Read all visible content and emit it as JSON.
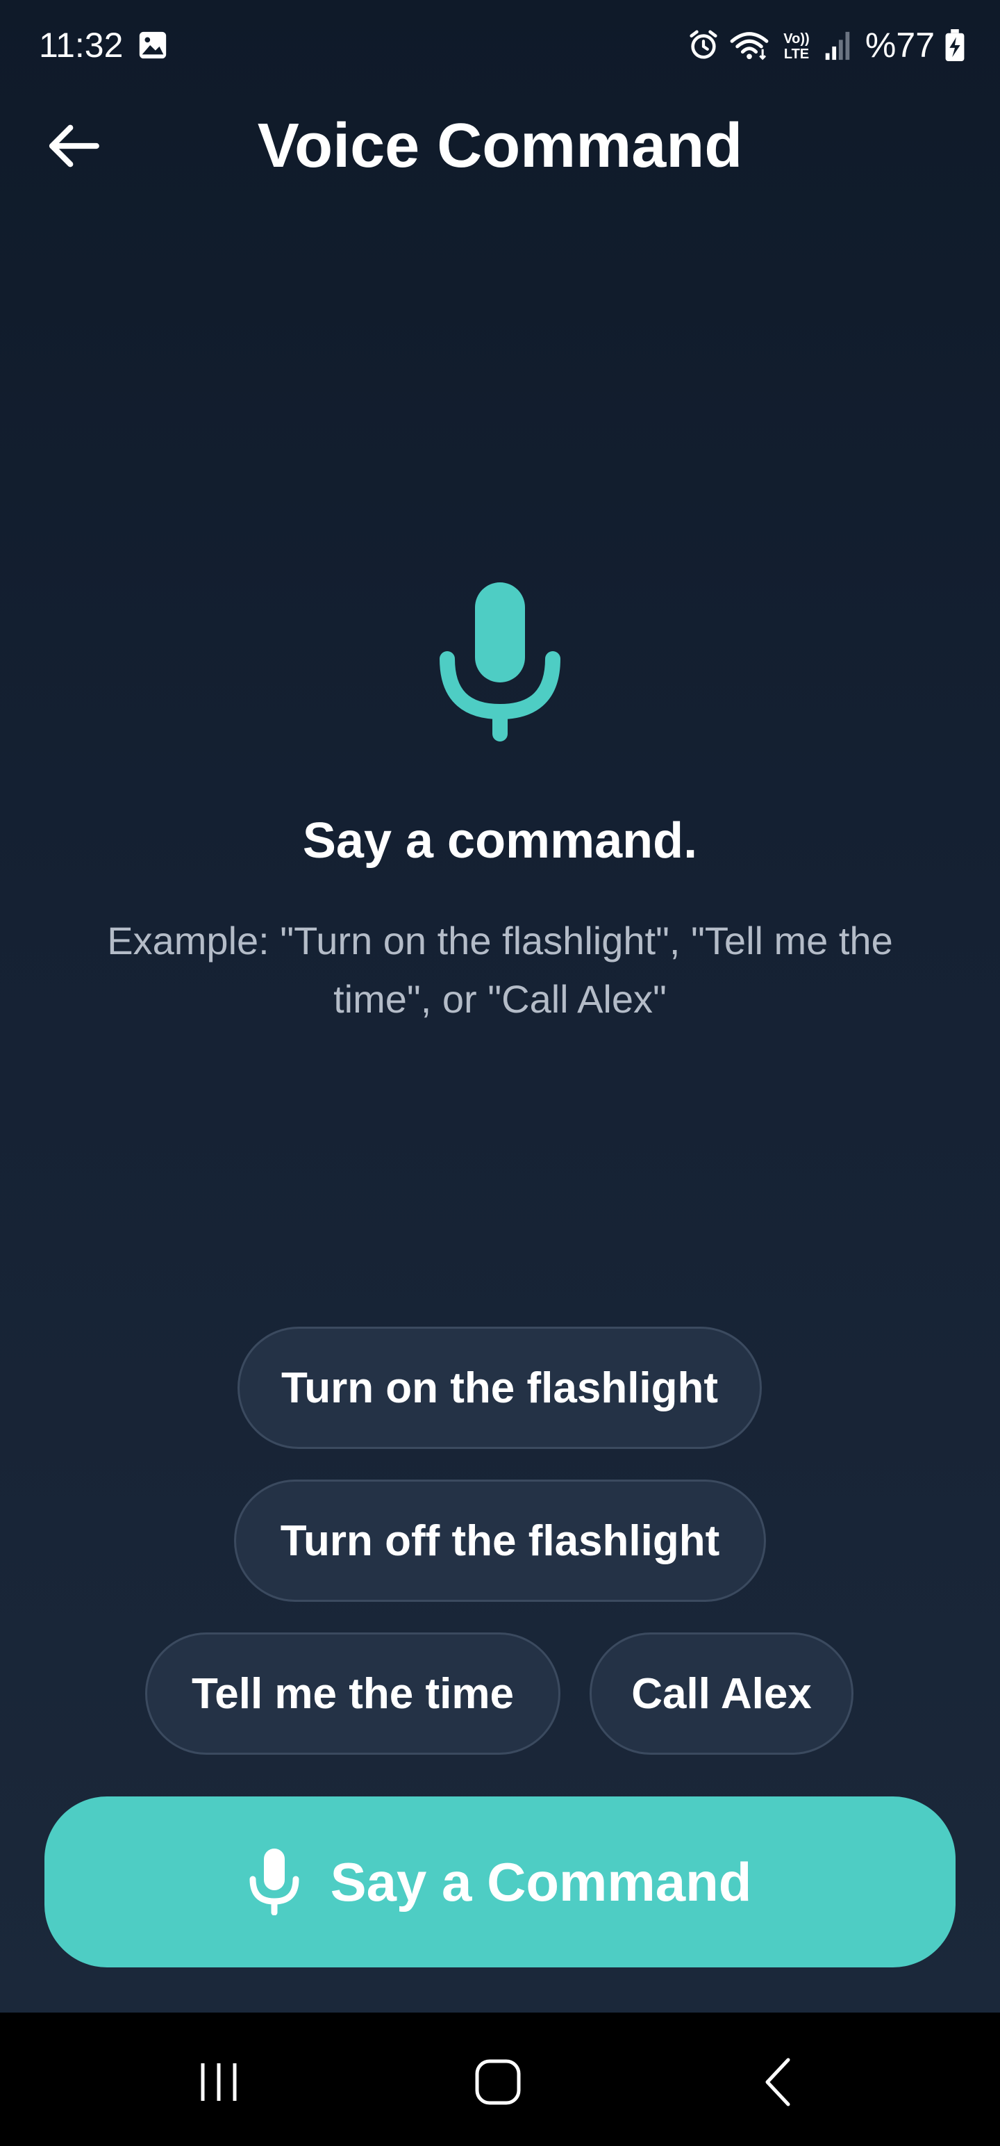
{
  "status_bar": {
    "time": "11:32",
    "battery": "%77",
    "icons": [
      "gallery-icon",
      "alarm-icon",
      "wifi-icon",
      "volte-icon",
      "signal-icon",
      "battery-charging-icon"
    ],
    "volte_text_top": "Vo))",
    "volte_text_bottom": "LTE"
  },
  "app_bar": {
    "title": "Voice Command",
    "back_icon": "arrow-left-icon"
  },
  "main": {
    "mic_icon": "microphone-icon",
    "accent_color": "#4ecdc4",
    "heading": "Say a command.",
    "example": "Example: \"Turn on the flashlight\", \"Tell me the time\", or \"Call Alex\""
  },
  "suggestions": [
    {
      "label": "Turn on the flashlight"
    },
    {
      "label": "Turn off the flashlight"
    },
    {
      "label": "Tell me the time"
    },
    {
      "label": "Call Alex"
    }
  ],
  "primary_button": {
    "label": "Say a Command",
    "icon": "microphone-icon",
    "color": "#4ecdc4"
  },
  "nav_bar": {
    "icons": [
      "recent-apps-icon",
      "home-icon",
      "back-icon"
    ]
  }
}
